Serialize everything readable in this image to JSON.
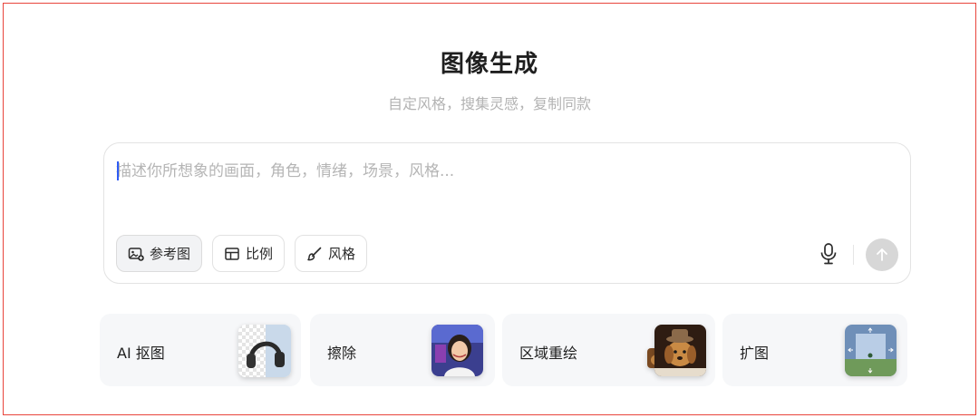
{
  "header": {
    "title": "图像生成",
    "subtitle": "自定风格，搜集灵感，复制同款"
  },
  "prompt": {
    "placeholder": "描述你所想象的画面，角色，情绪，场景，风格...",
    "value": ""
  },
  "options": [
    {
      "label": "参考图",
      "icon": "image-add-icon"
    },
    {
      "label": "比例",
      "icon": "aspect-ratio-icon"
    },
    {
      "label": "风格",
      "icon": "brush-icon"
    }
  ],
  "actions": {
    "voice_icon": "microphone-icon",
    "send_icon": "arrow-up-icon"
  },
  "tools": [
    {
      "label": "AI 抠图",
      "thumb": "headphones-cutout-thumbnail"
    },
    {
      "label": "擦除",
      "thumb": "girl-portrait-thumbnail"
    },
    {
      "label": "区域重绘",
      "thumb": "dog-with-hat-thumbnail"
    },
    {
      "label": "扩图",
      "thumb": "landscape-expand-thumbnail"
    }
  ],
  "colors": {
    "frame_border": "#e8453c",
    "caret": "#2f5cf5",
    "send_disabled": "#d7d7d7",
    "card_bg": "#f6f7f9"
  }
}
